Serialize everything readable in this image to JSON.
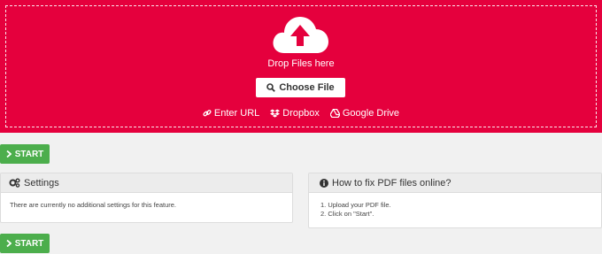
{
  "dropzone": {
    "drop_label": "Drop Files here",
    "choose_file_label": "Choose File",
    "sources": [
      {
        "icon": "link-icon",
        "label": "Enter URL"
      },
      {
        "icon": "dropbox-icon",
        "label": "Dropbox"
      },
      {
        "icon": "google-drive-icon",
        "label": "Google Drive"
      }
    ],
    "accent": "#e5003d"
  },
  "start_button": {
    "label": "START",
    "color": "#4cae4c"
  },
  "settings_panel": {
    "title": "Settings",
    "body": "There are currently no additional settings for this feature."
  },
  "howto_panel": {
    "title": "How to fix PDF files online?",
    "steps": [
      "1. Upload your PDF file.",
      "2. Click on \"Start\"."
    ]
  }
}
